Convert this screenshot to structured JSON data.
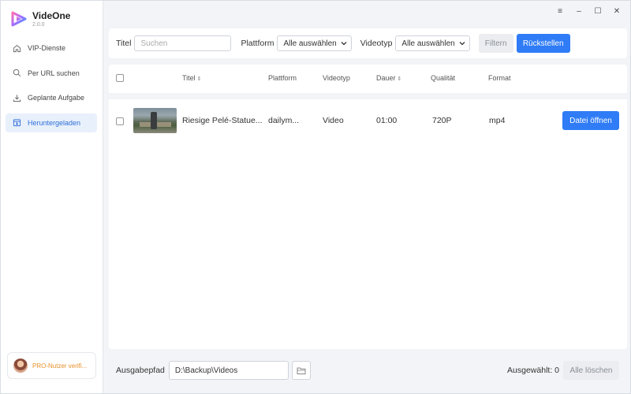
{
  "app": {
    "name": "VideOne",
    "version": "2.0.0",
    "accent": "#2f7cf6"
  },
  "window_controls": {
    "menu": "≡",
    "minimize": "–",
    "maximize": "☐",
    "close": "✕"
  },
  "sidebar": {
    "items": [
      {
        "label": "VIP-Dienste",
        "icon": "home-icon",
        "active": false
      },
      {
        "label": "Per URL suchen",
        "icon": "search-icon",
        "active": false
      },
      {
        "label": "Geplante Aufgabe",
        "icon": "download-icon",
        "active": false
      },
      {
        "label": "Heruntergeladen",
        "icon": "downloaded-box-icon",
        "active": true
      }
    ],
    "pro_status": "PRO-Nutzer verifi..."
  },
  "filter": {
    "title_label": "Titel",
    "search_placeholder": "Suchen",
    "platform_label": "Plattform",
    "platform_value": "Alle auswählen",
    "videotype_label": "Videotyp",
    "videotype_value": "Alle auswählen",
    "filter_button": "Filtern",
    "reset_button": "Rückstellen"
  },
  "table": {
    "columns": [
      "Titel",
      "Plattform",
      "Videotyp",
      "Dauer",
      "Qualität",
      "Format"
    ],
    "rows": [
      {
        "title": "Riesige Pelé-Statue...",
        "platform": "dailym...",
        "videotype": "Video",
        "duration": "01:00",
        "quality": "720P",
        "format": "mp4",
        "action": "Datei öffnen"
      }
    ]
  },
  "bottom": {
    "output_label": "Ausgabepfad",
    "output_path": "D:\\Backup\\Videos",
    "selected_label": "Ausgewählt: 0",
    "delete_all_button": "Alle löschen"
  }
}
